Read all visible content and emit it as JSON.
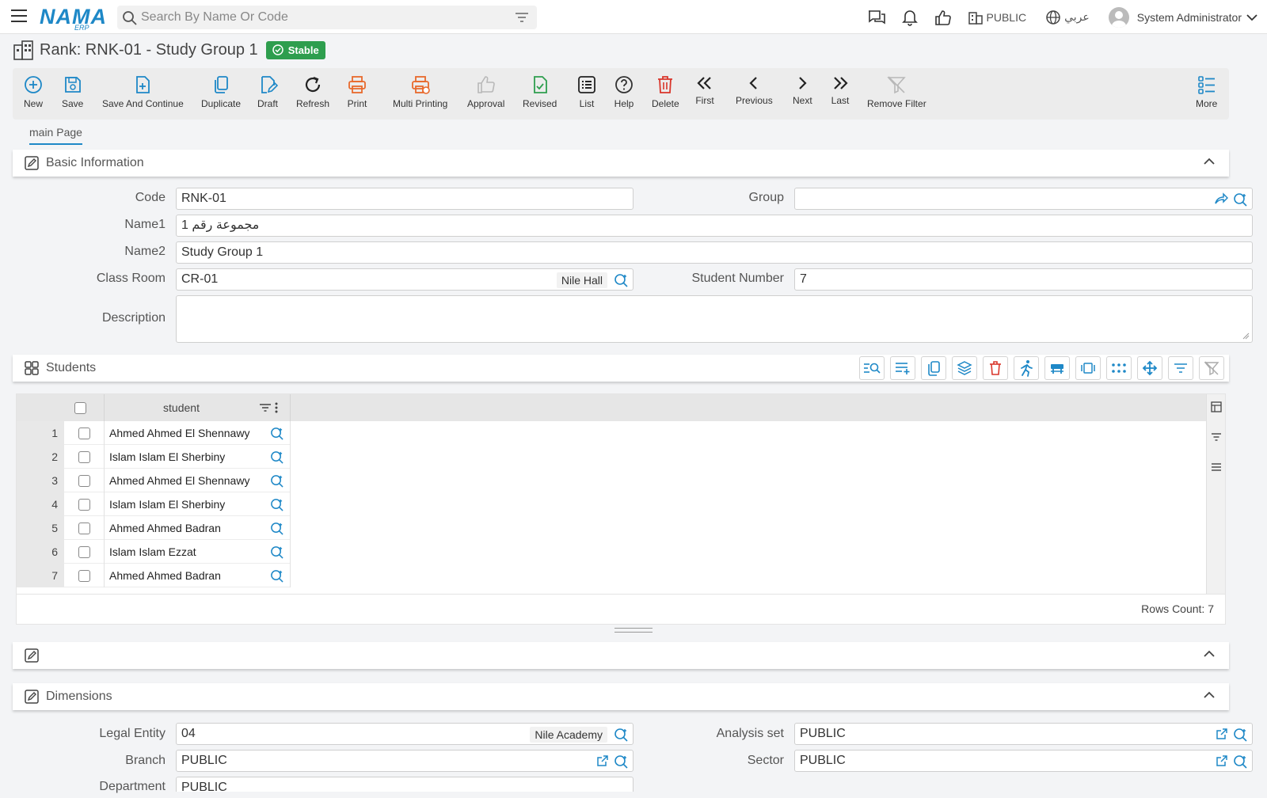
{
  "topbar": {
    "logo_main": "NAMA",
    "logo_sub": "ERP",
    "search_placeholder": "Search By Name Or Code",
    "legal_entity": "PUBLIC",
    "language": "عربي",
    "user_name": "System Administrator"
  },
  "page": {
    "title": "Rank: RNK-01 - Study Group 1",
    "status_badge": "Stable"
  },
  "toolbar": {
    "buttons": [
      {
        "label": "New",
        "icon": "plus-circle-icon"
      },
      {
        "label": "Save",
        "icon": "save-icon"
      },
      {
        "label": "Save And Continue",
        "icon": "file-plus-icon"
      },
      {
        "label": "Duplicate",
        "icon": "copy-icon"
      },
      {
        "label": "Draft",
        "icon": "file-edit-icon"
      },
      {
        "label": "Refresh",
        "icon": "refresh-icon"
      },
      {
        "label": "Print",
        "icon": "printer-icon"
      },
      {
        "label": "Multi Printing",
        "icon": "multi-printer-icon"
      },
      {
        "label": "Approval",
        "icon": "thumbs-up-icon"
      },
      {
        "label": "Revised",
        "icon": "file-check-icon"
      },
      {
        "label": "List",
        "icon": "list-icon"
      },
      {
        "label": "Help",
        "icon": "help-icon"
      },
      {
        "label": "Delete",
        "icon": "trash-icon"
      },
      {
        "label": "First",
        "icon": "chevrons-left-icon"
      },
      {
        "label": "Previous",
        "icon": "chevron-left-icon"
      },
      {
        "label": "Next",
        "icon": "chevron-right-icon"
      },
      {
        "label": "Last",
        "icon": "chevrons-right-icon"
      },
      {
        "label": "Remove Filter",
        "icon": "filter-off-icon"
      },
      {
        "label": "More",
        "icon": "more-list-icon"
      }
    ]
  },
  "tabs": {
    "main": "main Page"
  },
  "basic_info": {
    "title": "Basic Information",
    "code_label": "Code",
    "code_value": "RNK-01",
    "group_label": "Group",
    "group_value": "",
    "name1_label": "Name1",
    "name1_value": "مجموعة رقم 1",
    "name2_label": "Name2",
    "name2_value": "Study Group 1",
    "classroom_label": "Class Room",
    "classroom_value": "CR-01",
    "classroom_chip": "Nile Hall",
    "student_number_label": "Student Number",
    "student_number_value": "7",
    "description_label": "Description",
    "description_value": ""
  },
  "students": {
    "title": "Students",
    "column_student": "student",
    "rows": [
      {
        "num": "1",
        "name": "Ahmed Ahmed El Shennawy"
      },
      {
        "num": "2",
        "name": "Islam Islam El Sherbiny"
      },
      {
        "num": "3",
        "name": "Ahmed Ahmed El Shennawy"
      },
      {
        "num": "4",
        "name": "Islam Islam El Sherbiny"
      },
      {
        "num": "5",
        "name": "Ahmed Ahmed Badran"
      },
      {
        "num": "6",
        "name": "Islam Islam Ezzat"
      },
      {
        "num": "7",
        "name": "Ahmed Ahmed Badran"
      }
    ],
    "rows_count": "Rows Count: 7"
  },
  "dimensions": {
    "title": "Dimensions",
    "legal_entity_label": "Legal Entity",
    "legal_entity_value": "04",
    "legal_entity_chip": "Nile Academy",
    "analysis_set_label": "Analysis set",
    "analysis_set_value": "PUBLIC",
    "branch_label": "Branch",
    "branch_value": "PUBLIC",
    "sector_label": "Sector",
    "sector_value": "PUBLIC",
    "department_label": "Department",
    "department_value": "PUBLIC"
  },
  "colors": {
    "accent": "#1e88c7",
    "success": "#2e9e4e",
    "danger": "#d9362b",
    "print": "#e8692c"
  }
}
